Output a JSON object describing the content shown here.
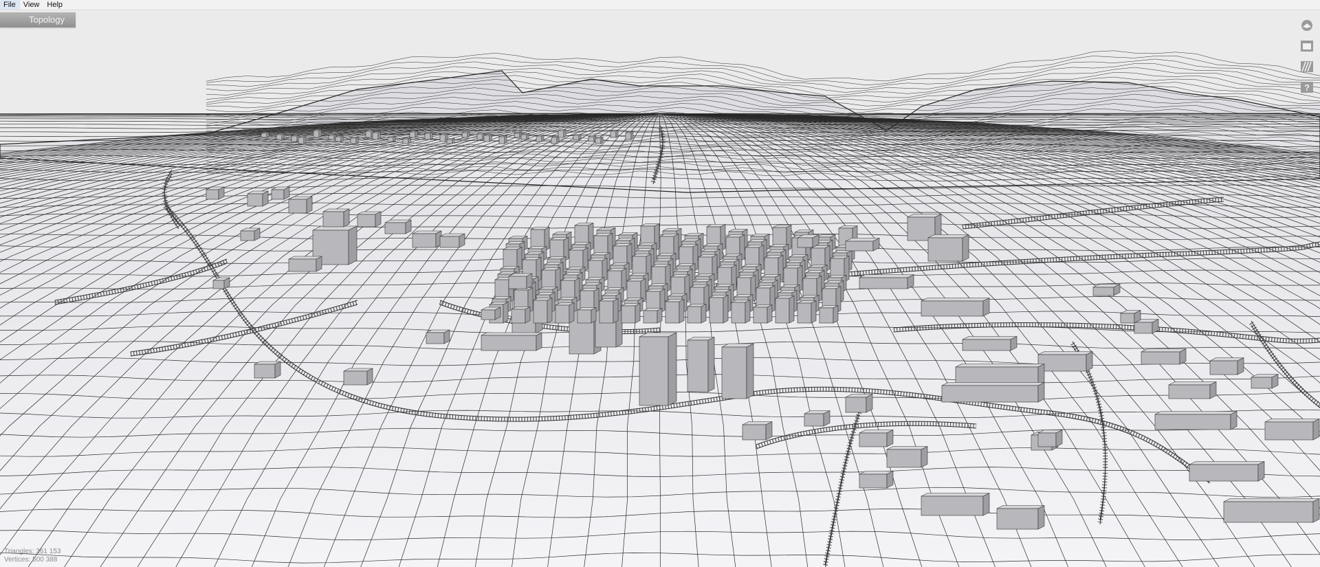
{
  "menu": {
    "file": "File",
    "view": "View",
    "help": "Help"
  },
  "tab": {
    "label": "Topology"
  },
  "toolbar": {
    "icons": [
      "compass-icon",
      "box-icon",
      "hatch-icon",
      "help-icon"
    ],
    "help_glyph": "?"
  },
  "stats": {
    "triangles": "Triangles: 361 153",
    "vertices": "Vertices: 500 388"
  },
  "colors": {
    "background": "#ebebeb",
    "terrain": "#f1f1f4",
    "building": "#b9b9bd",
    "wire": "#1a1a1a"
  }
}
